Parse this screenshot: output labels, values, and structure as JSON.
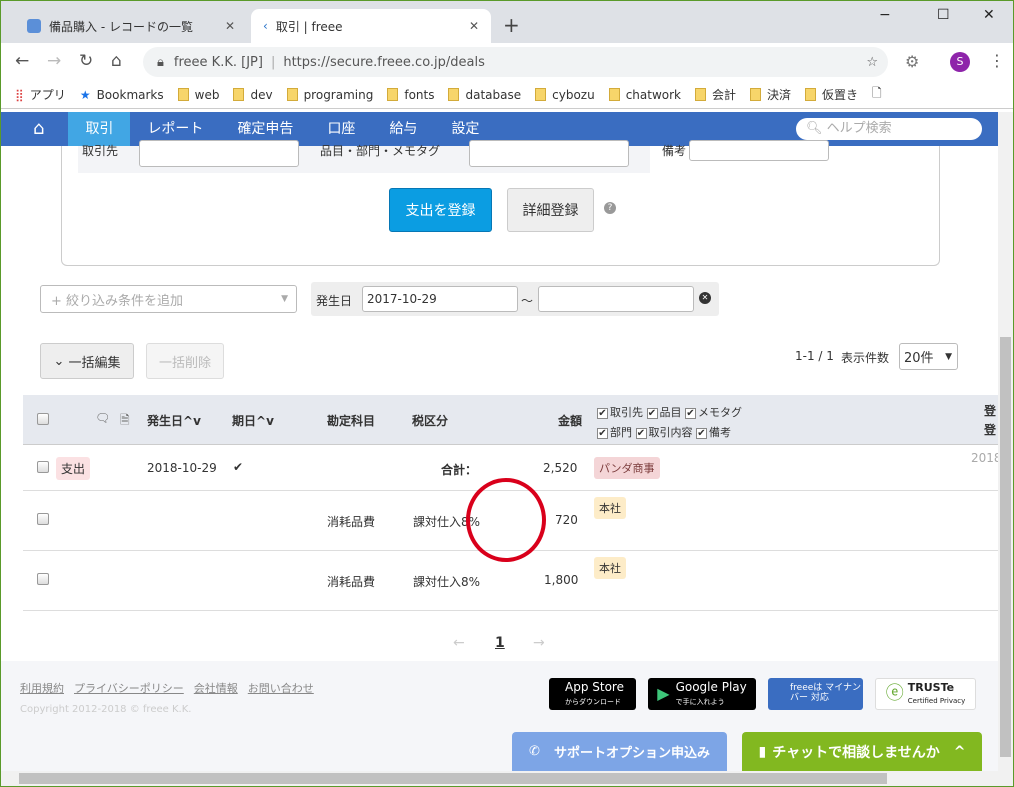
{
  "browser": {
    "tabs": [
      {
        "title": "備品購入 - レコードの一覧",
        "active": false
      },
      {
        "title": "取引 | freee",
        "active": true
      }
    ],
    "new_tab": "+",
    "window_controls": [
      "−",
      "☐",
      "✕"
    ],
    "site_identity": "freee K.K. [JP]",
    "url": "https://secure.freee.co.jp/deals",
    "profile_initial": "S",
    "bookmarks": [
      "アプリ",
      "Bookmarks",
      "web",
      "dev",
      "programing",
      "fonts",
      "database",
      "cybozu",
      "chatwork",
      "会計",
      "決済",
      "仮置き"
    ]
  },
  "nav": {
    "items": [
      "取引",
      "レポート",
      "確定申告",
      "口座",
      "給与",
      "設定"
    ],
    "active": "取引",
    "help_placeholder": "ヘルプ検索",
    "accent": "#3a6dc1"
  },
  "form": {
    "partner_label": "取引先",
    "item_label": "品目・部門・メモタグ",
    "note_label": "備考",
    "submit": "支出を登録",
    "detail": "詳細登録"
  },
  "filter": {
    "add_placeholder": "+ 絞り込み条件を追加",
    "date_label": "発生日",
    "date_from": "2017-10-29",
    "tilde": "〜",
    "date_to": ""
  },
  "actions": {
    "bulk_edit": "一括編集",
    "bulk_delete": "一括削除",
    "range": "1-1 / 1",
    "per_page_label": "表示件数",
    "per_page": "20件"
  },
  "table": {
    "headers": {
      "date": "発生日",
      "due": "期日",
      "account": "勘定科目",
      "tax": "税区分",
      "amount": "金額",
      "reg1": "登",
      "reg2": "登"
    },
    "column_toggles": [
      "取引先",
      "品目",
      "メモタグ",
      "部門",
      "取引内容",
      "備考"
    ],
    "deal": {
      "type": "支出",
      "date": "2018-10-29",
      "total_label": "合計：",
      "total": "2,520",
      "partner": "パンダ商事",
      "reg": "2018"
    },
    "lines": [
      {
        "account": "消耗品費",
        "tax": "課対仕入8%",
        "amount": "720",
        "department": "本社"
      },
      {
        "account": "消耗品費",
        "tax": "課対仕入8%",
        "amount": "1,800",
        "department": "本社"
      }
    ]
  },
  "pagination": {
    "prev": "←",
    "page": "1",
    "next": "→"
  },
  "footer": {
    "links": [
      "利用規約",
      "プライバシーポリシー",
      "会社情報",
      "お問い合わせ"
    ],
    "copyright": "Copyright 2012-2018 © freee K.K.",
    "badges": {
      "appstore": "App Store",
      "appstore_sub": "からダウンロード",
      "gplay": "Google Play",
      "gplay_sub": "で手に入れよう",
      "mynumber": "freeeは マイナンバー 対応",
      "truste": "TRUSTe",
      "truste_sub": "Certified Privacy"
    }
  },
  "support": {
    "option": "サポートオプション申込み",
    "chat": "チャットで相談しませんか"
  }
}
